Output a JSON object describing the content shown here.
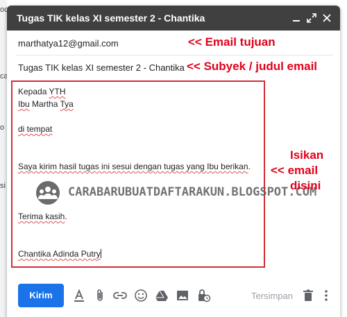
{
  "background": {
    "snippets": [
      "oc",
      "ca",
      "o",
      "si"
    ]
  },
  "compose": {
    "title": "Tugas TIK kelas XI semester 2 - Chantika",
    "to": "marthatya12@gmail.com",
    "subject": "Tugas TIK kelas XI semester 2 - Chantika",
    "body_lines": {
      "greeting": [
        "Kepada ",
        "YTH"
      ],
      "name": [
        "Ibu",
        " Martha ",
        "Tya"
      ],
      "place": [
        "di tempat"
      ],
      "message": [
        "Saya kirim hasil tugas ini sesui dengan tugas yang ",
        "Ibu berikan",
        "."
      ],
      "closing": [
        "Terima kasih",
        "."
      ],
      "signature": [
        "Chantika Adinda Putry"
      ]
    }
  },
  "annotations": {
    "to": "<< Email tujuan",
    "subject": "<< Subyek / judul email",
    "body_line1": "Isikan",
    "body_line2": "<< email",
    "body_line3": "disini"
  },
  "watermark": "CARABARUBUATDAFTARAKUN.BLOGSPOT.COM",
  "toolbar": {
    "send_label": "Kirim",
    "saved_label": "Tersimpan",
    "icons": [
      "format-text-icon",
      "attach-icon",
      "link-icon",
      "emoji-icon",
      "drive-icon",
      "photo-icon",
      "confidential-icon",
      "delete-icon",
      "more-icon"
    ]
  },
  "colors": {
    "titlebar": "#404040",
    "annotation": "#e2001a",
    "box_border": "#d32d35",
    "send_button": "#1a73e8"
  }
}
